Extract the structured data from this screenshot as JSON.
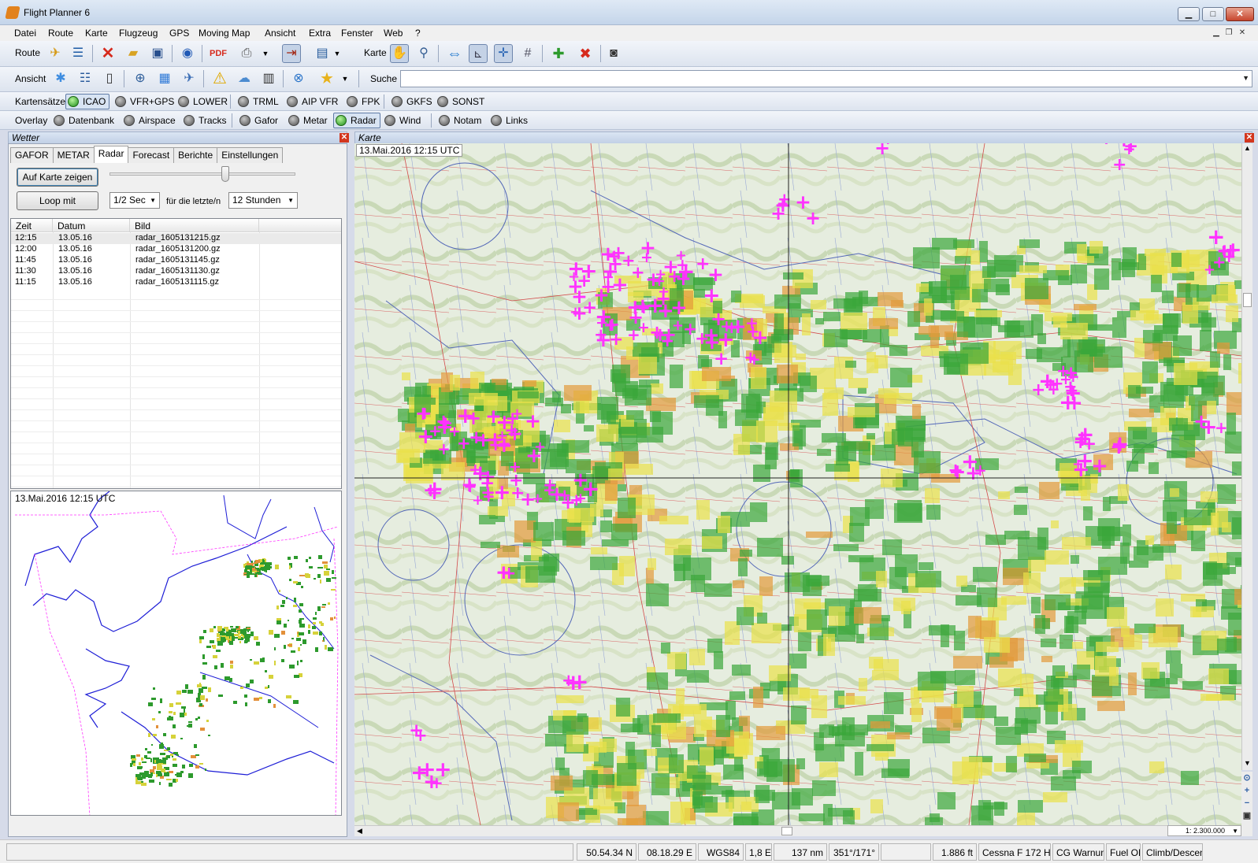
{
  "window": {
    "title": "Flight Planner 6",
    "min": "▁",
    "max": "□",
    "close": "✕"
  },
  "menu": [
    "Datei",
    "Route",
    "Karte",
    "Flugzeug",
    "GPS",
    "Moving Map",
    "Ansicht",
    "Extra",
    "Fenster",
    "Web",
    "?"
  ],
  "toolbar1": {
    "route_label": "Route",
    "karte_label": "Karte"
  },
  "toolbar2": {
    "ansicht_label": "Ansicht",
    "search_label": "Suche",
    "search_value": ""
  },
  "kartensaetze": {
    "label": "Kartensätze",
    "items": [
      "ICAO",
      "VFR+GPS",
      "LOWER",
      "TRML",
      "AIP VFR",
      "FPK",
      "GKFS",
      "SONST"
    ]
  },
  "overlay": {
    "label": "Overlay",
    "items": [
      "Datenbank",
      "Airspace",
      "Tracks",
      "Gafor",
      "Metar",
      "Radar",
      "Wind",
      "Notam",
      "Links"
    ]
  },
  "weather_panel": {
    "title": "Wetter",
    "tabs": [
      "GAFOR",
      "METAR",
      "Radar",
      "Forecast",
      "Berichte",
      "Einstellungen"
    ],
    "show_on_map": "Auf Karte zeigen",
    "loop_button": "Loop mit",
    "interval": "1/2 Sec",
    "for_last": "für die letzte/n",
    "period": "12 Stunden",
    "slider_level": 0.63,
    "columns": [
      "Zeit",
      "Datum",
      "Bild"
    ],
    "rows": [
      [
        "12:15",
        "13.05.16",
        "radar_1605131215.gz"
      ],
      [
        "12:00",
        "13.05.16",
        "radar_1605131200.gz"
      ],
      [
        "11:45",
        "13.05.16",
        "radar_1605131145.gz"
      ],
      [
        "11:30",
        "13.05.16",
        "radar_1605131130.gz"
      ],
      [
        "11:15",
        "13.05.16",
        "radar_1605131115.gz"
      ]
    ],
    "minimap_timestamp": "13.Mai.2016 12:15 UTC"
  },
  "map_panel": {
    "title": "Karte",
    "timestamp": "13.Mai.2016 12:15 UTC",
    "scale": "1: 2.300.000"
  },
  "status": [
    "50.54.34 N",
    "08.18.29 E",
    "WGS84",
    "1,8 E",
    "137 nm",
    "351°/171°",
    "",
    "1.886 ft",
    "Cessna F 172 H",
    "CG Warnung",
    "Fuel OK",
    "Climb/Descend"
  ],
  "colors": {
    "radar_strong": "#ff33ff",
    "radar_green": "#3ba63b",
    "radar_yellow": "#e9e14a",
    "active_led": "#2aa12a"
  }
}
